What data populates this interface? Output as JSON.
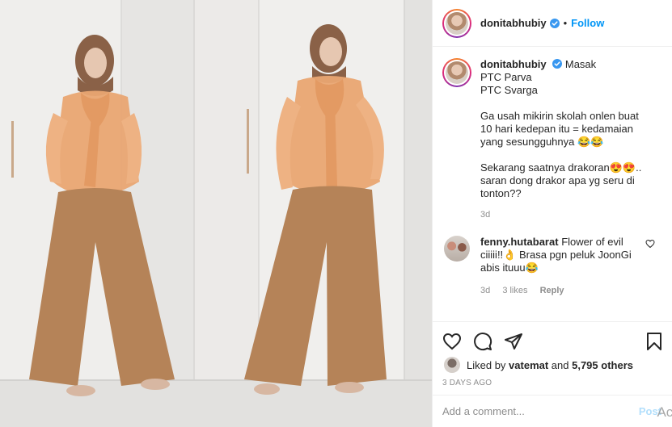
{
  "header": {
    "username": "donitabhubiy",
    "separator": "•",
    "follow_label": "Follow"
  },
  "caption": {
    "username": "donitabhubiy",
    "lines": [
      "Masak",
      "PTC Parva",
      "PTC Svarga",
      "",
      "Ga usah mikirin skolah onlen buat",
      "10 hari kedepan itu = kedamaian",
      "yang sesungguhnya 😂😂",
      "",
      "Sekarang saatnya drakoran😍😍..",
      "saran dong drakor apa yg seru di",
      "tonton??"
    ],
    "age": "3d"
  },
  "comment": {
    "username": "fenny.hutabarat",
    "text_lines": [
      "Flower of evil",
      "ciiiii!!👌 Brasa pgn peluk JoonGi",
      "abis ituuu😂"
    ],
    "age": "3d",
    "likes": "3 likes",
    "reply_label": "Reply"
  },
  "actions": {
    "liked_by_prefix": "Liked by ",
    "liked_by_user": "vatemat",
    "liked_by_mid": " and ",
    "liked_by_count": "5,795 others",
    "date": "3 DAYS AGO"
  },
  "add_comment": {
    "placeholder": "Add a comment...",
    "post_label": "Post"
  },
  "overlay": {
    "text": "Act"
  },
  "colors": {
    "link_blue": "#0095f6",
    "muted": "#8e8e8e",
    "verified_blue": "#3897f0"
  }
}
